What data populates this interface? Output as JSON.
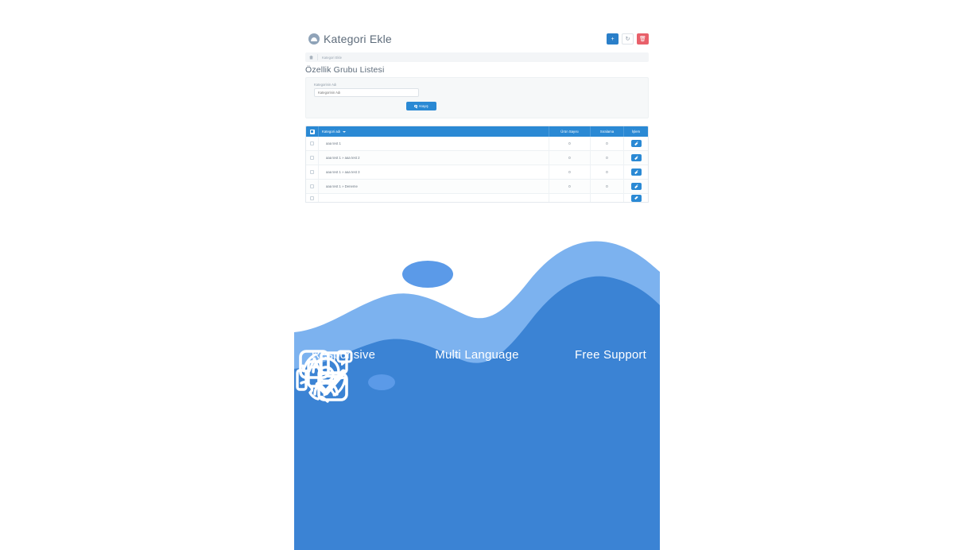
{
  "app": {
    "brand_title": "Kategori Ekle",
    "logo_icon": "circle-logo-icon",
    "header_buttons": [
      {
        "name": "add-button",
        "icon": "plus-icon",
        "glyph": "+",
        "color": "#2a7fc9"
      },
      {
        "name": "refresh-button",
        "icon": "refresh-icon",
        "glyph": "↻",
        "color": "#ffffff"
      },
      {
        "name": "delete-button",
        "icon": "trash-icon",
        "glyph": "🗑",
        "color": "#e8606a"
      }
    ],
    "breadcrumb": {
      "home_icon": "home-icon",
      "current": "Kategori Ekle"
    },
    "page_title": "Özellik Grubu Listesi"
  },
  "form": {
    "label": "Kategorinin Adı",
    "placeholder": "Kategorinin Adı",
    "value": "",
    "search_label": "Arayış",
    "search_icon": "search-icon"
  },
  "table": {
    "columns": {
      "select_all": "",
      "name": "Kategori adı",
      "product_count": "Ürün Sayısı",
      "order": "Sıralama",
      "actions": "İşlem"
    },
    "sort_indicator": "▼",
    "rows": [
      {
        "name": "aaa test 1",
        "product_count": "0",
        "order": "0",
        "action_icon": "edit-pencil-icon"
      },
      {
        "name": "aaa test 1 » aaa test 2",
        "product_count": "0",
        "order": "0",
        "action_icon": "edit-pencil-icon"
      },
      {
        "name": "aaa test 1 » aaa test 3",
        "product_count": "0",
        "order": "0",
        "action_icon": "edit-pencil-icon"
      },
      {
        "name": "aaa test 1 » Deneme",
        "product_count": "0",
        "order": "0",
        "action_icon": "edit-pencil-icon"
      }
    ],
    "partial_row": {
      "name": "",
      "product_count": "",
      "order": "",
      "action_icon": "edit-pencil-icon"
    }
  },
  "promo": {
    "wave_light": "#7cb2ef",
    "wave_dark": "#3b83d4",
    "features": [
      {
        "label": "Responsive",
        "icon": "devices-responsive-icon"
      },
      {
        "label": "Multi Language",
        "icon": "translate-language-icon"
      },
      {
        "label": "Free Support",
        "icon": "headset-support-icon"
      }
    ]
  }
}
